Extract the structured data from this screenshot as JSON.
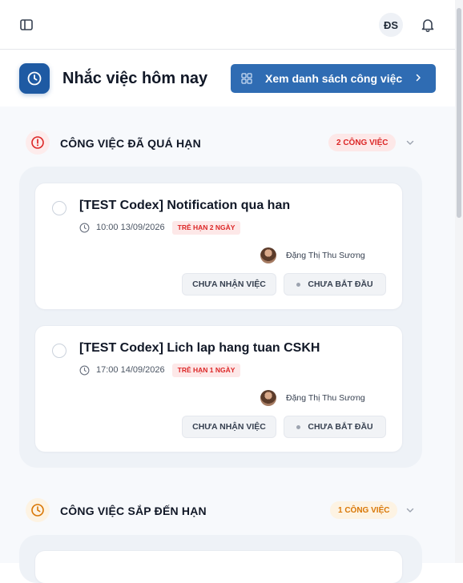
{
  "topbar": {
    "user_initials": "ĐS"
  },
  "header": {
    "title": "Nhắc việc hôm nay",
    "view_all_label": "Xem danh sách công việc"
  },
  "sections": [
    {
      "title": "CÔNG VIỆC ĐÃ QUÁ HẠN",
      "count_label": "2 CÔNG VIỆC",
      "accent": "#dc2626",
      "tasks": [
        {
          "title": "[TEST Codex] Notification qua han",
          "time": "10:00 13/09/2026",
          "late_label": "TRỄ HẠN 2 NGÀY",
          "assignee": "Đặng Thị Thu Sương",
          "accept_label": "CHƯA NHẬN VIỆC",
          "status_label": "CHƯA BẮT ĐẦU"
        },
        {
          "title": "[TEST Codex] Lich lap hang tuan CSKH",
          "time": "17:00 14/09/2026",
          "late_label": "TRỄ HẠN 1 NGÀY",
          "assignee": "Đặng Thị Thu Sương",
          "accept_label": "CHƯA NHẬN VIỆC",
          "status_label": "CHƯA BẮT ĐẦU"
        }
      ]
    },
    {
      "title": "CÔNG VIỆC SẮP ĐẾN HẠN",
      "count_label": "1 CÔNG VIỆC",
      "accent": "#d97706"
    }
  ],
  "colors": {
    "primary": "#2f6cb3",
    "primary_dark": "#1e5aa3",
    "overdue": "#dc2626",
    "upcoming": "#d97706"
  }
}
